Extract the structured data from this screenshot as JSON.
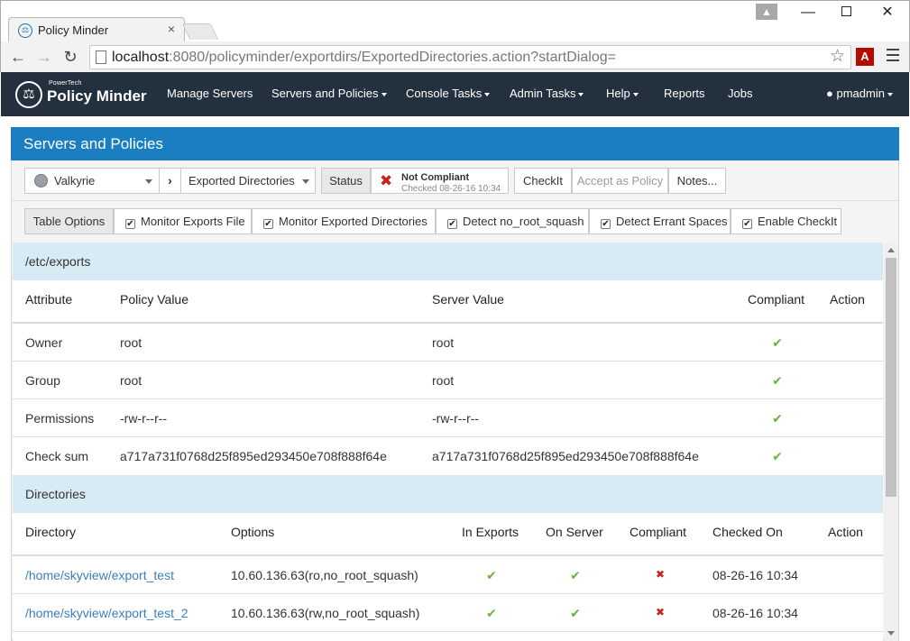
{
  "browser": {
    "tab_title": "Policy Minder",
    "url_host": "localhost",
    "url_rest": ":8080/policyminder/exportdirs/ExportedDirectories.action?startDialog="
  },
  "navbar": {
    "brand_small": "PowerTech",
    "brand_name": "Policy Minder",
    "items": [
      "Manage Servers",
      "Servers and Policies",
      "Console Tasks",
      "Admin Tasks",
      "Help",
      "Reports",
      "Jobs"
    ],
    "user": "pmadmin"
  },
  "panel": {
    "title": "Servers and Policies",
    "server_select": "Valkyrie",
    "policy_select": "Exported Directories",
    "status_label": "Status",
    "status_value": "Not Compliant",
    "status_checked": "Checked 08-26-16 10:34",
    "checkit_label": "CheckIt",
    "accept_label": "Accept as Policy",
    "notes_label": "Notes...",
    "table_options_label": "Table Options",
    "options": [
      "Monitor Exports File",
      "Monitor Exported Directories",
      "Detect no_root_squash",
      "Detect Errant Spaces",
      "Enable CheckIt"
    ]
  },
  "exports_section": {
    "title": "/etc/exports",
    "headers": [
      "Attribute",
      "Policy Value",
      "Server Value",
      "Compliant",
      "Action"
    ],
    "rows": [
      {
        "attribute": "Owner",
        "policy": "root",
        "server": "root",
        "compliant": true
      },
      {
        "attribute": "Group",
        "policy": "root",
        "server": "root",
        "compliant": true
      },
      {
        "attribute": "Permissions",
        "policy": "-rw-r--r--",
        "server": "-rw-r--r--",
        "compliant": true
      },
      {
        "attribute": "Check sum",
        "policy": "a717a731f0768d25f895ed293450e708f888f64e",
        "server": "a717a731f0768d25f895ed293450e708f888f64e",
        "compliant": true
      }
    ]
  },
  "directories_section": {
    "title": "Directories",
    "headers": [
      "Directory",
      "Options",
      "In Exports",
      "On Server",
      "Compliant",
      "Checked On",
      "Action"
    ],
    "rows": [
      {
        "directory": "/home/skyview/export_test",
        "options": "10.60.136.63(ro,no_root_squash)",
        "in_exports": true,
        "on_server": true,
        "compliant": false,
        "checked_on": "08-26-16 10:34"
      },
      {
        "directory": "/home/skyview/export_test_2",
        "options": "10.60.136.63(rw,no_root_squash)",
        "in_exports": true,
        "on_server": true,
        "compliant": false,
        "checked_on": "08-26-16 10:34"
      }
    ]
  },
  "colors": {
    "navbar_bg": "#23303d",
    "panel_header": "#1b7ec0",
    "section_bg": "#d7ebf5",
    "compliant_green": "#6db33f",
    "noncompliant_red": "#c9211e",
    "link": "#3a7ebf"
  }
}
